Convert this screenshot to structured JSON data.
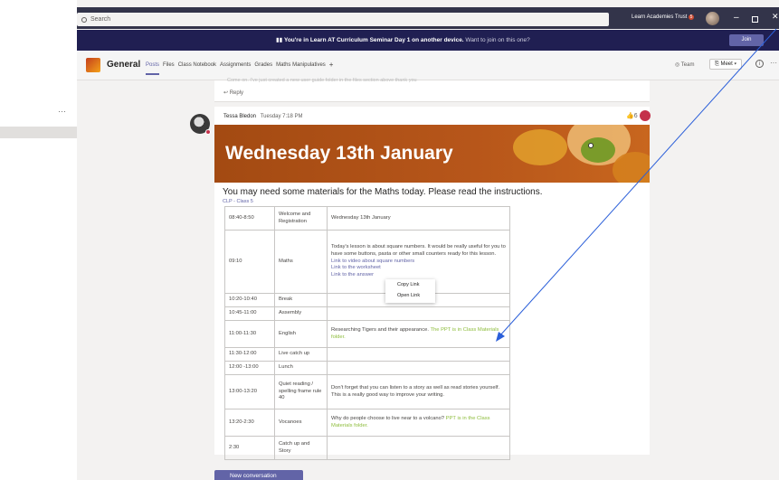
{
  "search": {
    "placeholder": "Search"
  },
  "account": {
    "org": "Learn Academies Trust",
    "notif_count": "5"
  },
  "banner": {
    "bold": "You're in Learn AT Curriculum Seminar Day 1 on another device.",
    "rest": "Want to join on this one?",
    "join": "Join"
  },
  "channel": {
    "name": "General",
    "tabs": [
      "Posts",
      "Files",
      "Class Notebook",
      "Assignments",
      "Grades",
      "Maths Manipulatives"
    ],
    "team_btn": "Team",
    "meet_btn": "Meet"
  },
  "prev": {
    "cut_text": "Come on. I've just created a new user guide folder in the files section above thank you",
    "reply": "Reply"
  },
  "post": {
    "author": "Tessa Bledon",
    "time": "Tuesday 7:18 PM",
    "likes": "6",
    "hero_title": "Wednesday 13th January",
    "subtitle": "You may need some materials for the Maths today. Please read the instructions.",
    "tag": "CLP - Class 5",
    "rows": [
      {
        "time": "08:40-8:50",
        "subject": "Welcome and Registration",
        "notes": "Wednesday 13th January"
      },
      {
        "time": "09:10",
        "subject": "Maths",
        "notes": "Today's lesson is about square numbers. It would be really useful for you to have some buttons, pasta or other small counters ready for this lesson.",
        "links": [
          "Link to video about square numbers",
          "Link to the worksheet",
          "Link to the answer"
        ]
      },
      {
        "time": "10:20-10:40",
        "subject": "Break",
        "notes": ""
      },
      {
        "time": "10:45-11:00",
        "subject": "Assembly",
        "notes": ""
      },
      {
        "time": "11:00-11:30",
        "subject": "English",
        "notes": "Researching Tigers and their appearance.",
        "green": "The PPT is in Class Materials folder."
      },
      {
        "time": "11:30-12:00",
        "subject": "Live catch up",
        "notes": ""
      },
      {
        "time": "12:00 -13:00",
        "subject": "Lunch",
        "notes": ""
      },
      {
        "time": "13:00-13:20",
        "subject": "Quiet reading / spelling frame rule 40",
        "notes": "Don't forget that you can listen to a story as well as read stories yourself. This is a really good way to improve your writing."
      },
      {
        "time": "13:20-2:30",
        "subject": "Vocanoes",
        "notes": "Why do people choose to live near to a volcano?",
        "green": "PPT is in the Class Materials folder."
      },
      {
        "time": "2:30",
        "subject": "Catch up and Story",
        "notes": ""
      }
    ]
  },
  "context_menu": {
    "copy": "Copy Link",
    "open": "Open Link"
  },
  "new_conversation": "New conversation",
  "colors": {
    "accent": "#6264a7",
    "banner": "#201f52",
    "titlebar": "#33344a",
    "hero": "#b7561a",
    "arrow": "#2b5fd9"
  }
}
